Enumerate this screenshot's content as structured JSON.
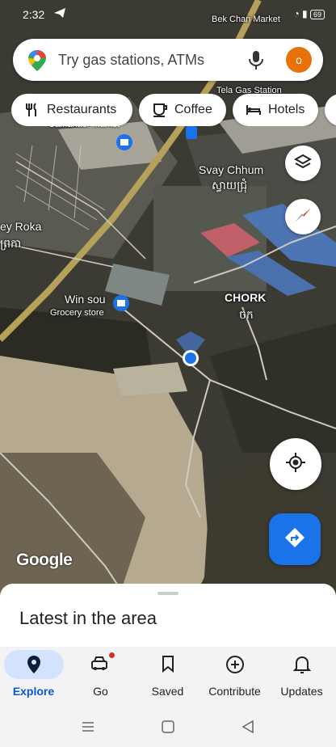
{
  "status_bar": {
    "time": "2:32",
    "battery": "69"
  },
  "search": {
    "placeholder": "Try gas stations, ATMs",
    "avatar_initial": "o"
  },
  "chips": [
    {
      "label": "Restaurants",
      "icon": "fork-knife-icon"
    },
    {
      "label": "Coffee",
      "icon": "coffee-icon"
    },
    {
      "label": "Hotels",
      "icon": "bed-icon"
    }
  ],
  "map_labels": {
    "bek_chan_market": "Bek Chan Market",
    "tela_gas_station": "Tela Gas Station",
    "camahaer_market": "Camahaer Market",
    "svay_chhum": "Svay Chhum",
    "svay_chhum_khmer": "ស្វាយជ្រុំ",
    "ey_roka": "ey Roka",
    "ey_roka_khmer": "ព្រកា",
    "win_sou": "Win sou",
    "grocery_store": "Grocery store",
    "chork": "CHORK",
    "chork_khmer": "ចក"
  },
  "google_logo": "Google",
  "sheet": {
    "title": "Latest in the area"
  },
  "nav": [
    {
      "label": "Explore",
      "icon": "explore-pin-icon",
      "active": true
    },
    {
      "label": "Go",
      "icon": "car-icon",
      "active": false
    },
    {
      "label": "Saved",
      "icon": "bookmark-icon",
      "active": false
    },
    {
      "label": "Contribute",
      "icon": "add-circle-icon",
      "active": false
    },
    {
      "label": "Updates",
      "icon": "bell-icon",
      "active": false
    }
  ],
  "colors": {
    "accent": "#1a73e8",
    "active_pill": "#d3e3fd",
    "avatar": "#e8710a"
  }
}
